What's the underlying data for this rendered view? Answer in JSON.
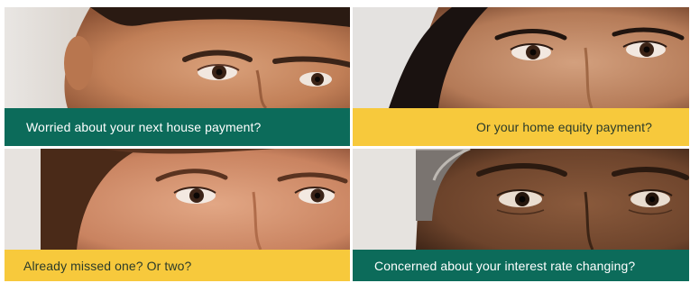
{
  "panels": {
    "top_left": {
      "caption": "Worried about your next house payment?",
      "band_color": "#0c6b5a"
    },
    "top_right": {
      "caption": "Or your home equity payment?",
      "band_color": "#f7c93c"
    },
    "bottom_left": {
      "caption": "Already missed one? Or two?",
      "band_color": "#f7c93c"
    },
    "bottom_right": {
      "caption": "Concerned about your interest rate changing?",
      "band_color": "#0c6b5a"
    }
  }
}
